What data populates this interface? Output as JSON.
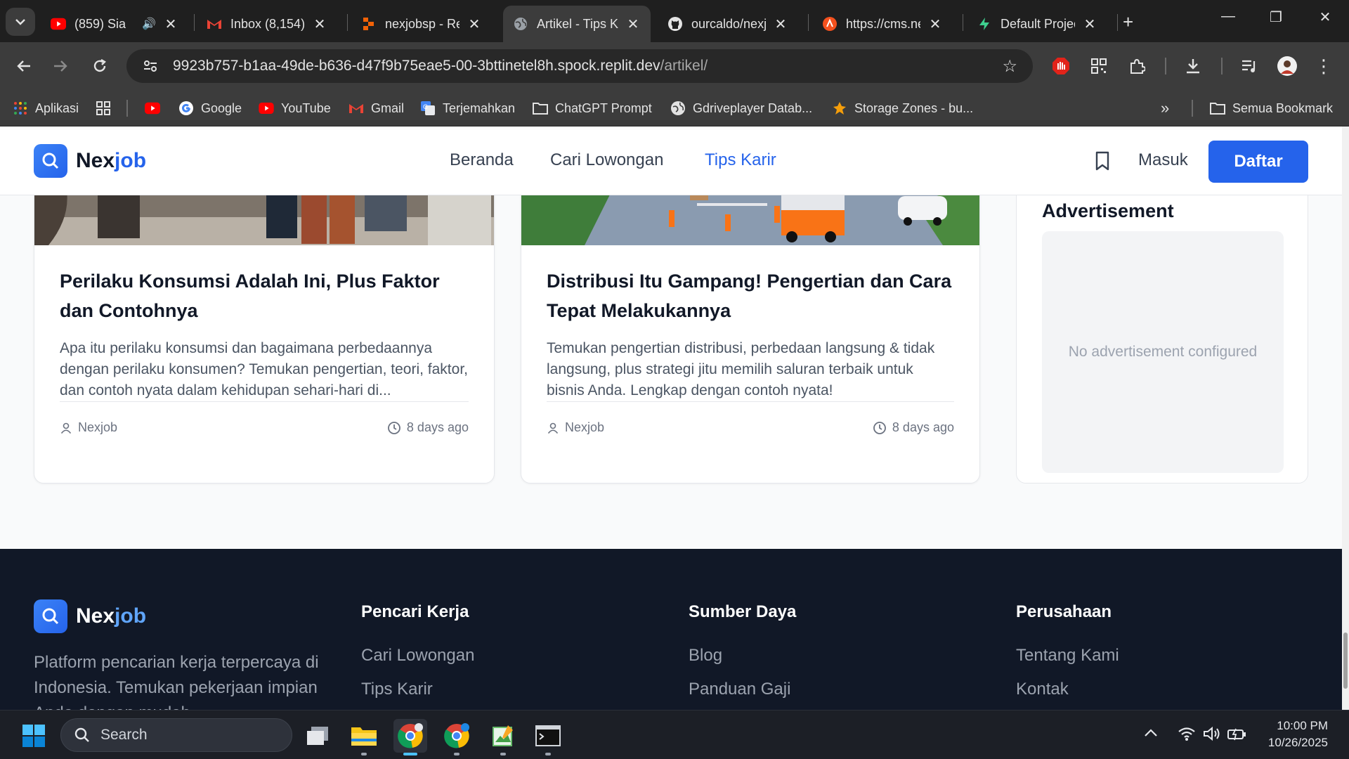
{
  "browser": {
    "tabs": [
      {
        "title": "(859) Sia",
        "favicon": "youtube-icon"
      },
      {
        "title": "Inbox (8,154)",
        "favicon": "gmail-icon"
      },
      {
        "title": "nexjobsp - Re",
        "favicon": "replit-icon"
      },
      {
        "title": "Artikel - Tips K",
        "favicon": "globe-icon"
      },
      {
        "title": "ourcaldo/nexj",
        "favicon": "github-icon"
      },
      {
        "title": "https://cms.ne",
        "favicon": "cms-icon"
      },
      {
        "title": "Default Projec",
        "favicon": "supabase-icon"
      }
    ],
    "url_host": "9923b757-b1aa-49de-b636-d47f9b75eae5-00-3bttinetel8h.spock.replit.dev",
    "url_path": "/artikel/",
    "bookmarks": [
      {
        "label": "Aplikasi"
      },
      {
        "label": "Google"
      },
      {
        "label": "YouTube"
      },
      {
        "label": "Gmail"
      },
      {
        "label": "Terjemahkan"
      },
      {
        "label": "ChatGPT Prompt"
      },
      {
        "label": "Gdriveplayer Datab..."
      },
      {
        "label": "Storage Zones - bu..."
      }
    ],
    "all_bookmarks": "Semua Bookmark"
  },
  "site": {
    "logo_a": "Nex",
    "logo_b": "job",
    "nav": [
      "Beranda",
      "Cari Lowongan",
      "Tips Karir"
    ],
    "login": "Masuk",
    "register": "Daftar",
    "brand_color": "#2563eb"
  },
  "articles": [
    {
      "title": "Perilaku Konsumsi Adalah Ini, Plus Faktor dan Contohnya",
      "excerpt": "Apa itu perilaku konsumsi dan bagaimana perbedaannya dengan perilaku konsumen? Temukan pengertian, teori, faktor, dan contoh nyata dalam kehidupan sehari-hari di...",
      "author": "Nexjob",
      "time": "8 days ago"
    },
    {
      "title": "Distribusi Itu Gampang! Pengertian dan Cara Tepat Melakukannya",
      "excerpt": "Temukan pengertian distribusi, perbedaan langsung & tidak langsung, plus strategi jitu memilih saluran terbaik untuk bisnis Anda. Lengkap dengan contoh nyata!",
      "author": "Nexjob",
      "time": "8 days ago"
    }
  ],
  "ad": {
    "title": "Advertisement",
    "empty": "No advertisement configured"
  },
  "footer": {
    "logo_a": "Nex",
    "logo_b": "job",
    "description": "Platform pencarian kerja terpercaya di Indonesia. Temukan pekerjaan impian Anda dengan mudah.",
    "columns": [
      {
        "title": "Pencari Kerja",
        "links": [
          "Cari Lowongan",
          "Tips Karir"
        ]
      },
      {
        "title": "Sumber Daya",
        "links": [
          "Blog",
          "Panduan Gaji"
        ]
      },
      {
        "title": "Perusahaan",
        "links": [
          "Tentang Kami",
          "Kontak"
        ]
      }
    ]
  },
  "taskbar": {
    "search": "Search",
    "time": "10:00 PM",
    "date": "10/26/2025"
  }
}
